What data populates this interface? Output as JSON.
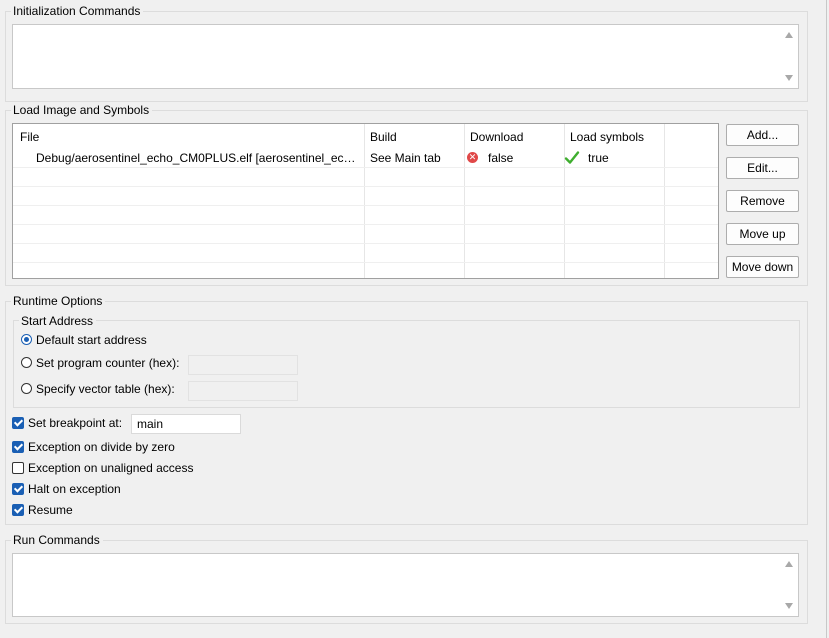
{
  "init_commands": {
    "title": "Initialization Commands"
  },
  "load_image": {
    "title": "Load Image and Symbols",
    "columns": [
      "File",
      "Build",
      "Download",
      "Load symbols"
    ],
    "rows": [
      {
        "file": "Debug/aerosentinel_echo_CM0PLUS.elf [aerosentinel_echo_...",
        "build": "See Main tab",
        "download": "false",
        "load_symbols": "true"
      }
    ],
    "buttons": {
      "add": "Add...",
      "edit": "Edit...",
      "remove": "Remove",
      "move_up": "Move up",
      "move_down": "Move down"
    }
  },
  "runtime": {
    "title": "Runtime Options",
    "start_address": {
      "title": "Start Address",
      "default": "Default start address",
      "program_counter": "Set program counter (hex):",
      "vector_table": "Specify vector table (hex):",
      "selected": "default"
    },
    "set_breakpoint": {
      "label": "Set breakpoint at:",
      "value": "main",
      "checked": true
    },
    "divide_by_zero": {
      "label": "Exception on divide by zero",
      "checked": true
    },
    "unaligned": {
      "label": "Exception on unaligned access",
      "checked": false
    },
    "halt": {
      "label": "Halt on exception",
      "checked": true
    },
    "resume": {
      "label": "Resume",
      "checked": true
    }
  },
  "run_commands": {
    "title": "Run Commands"
  },
  "colors": {
    "accent": "#1a5fb4",
    "error_icon": "#e04848",
    "success_icon": "#3fae2f",
    "background": "#f0f0f0"
  }
}
